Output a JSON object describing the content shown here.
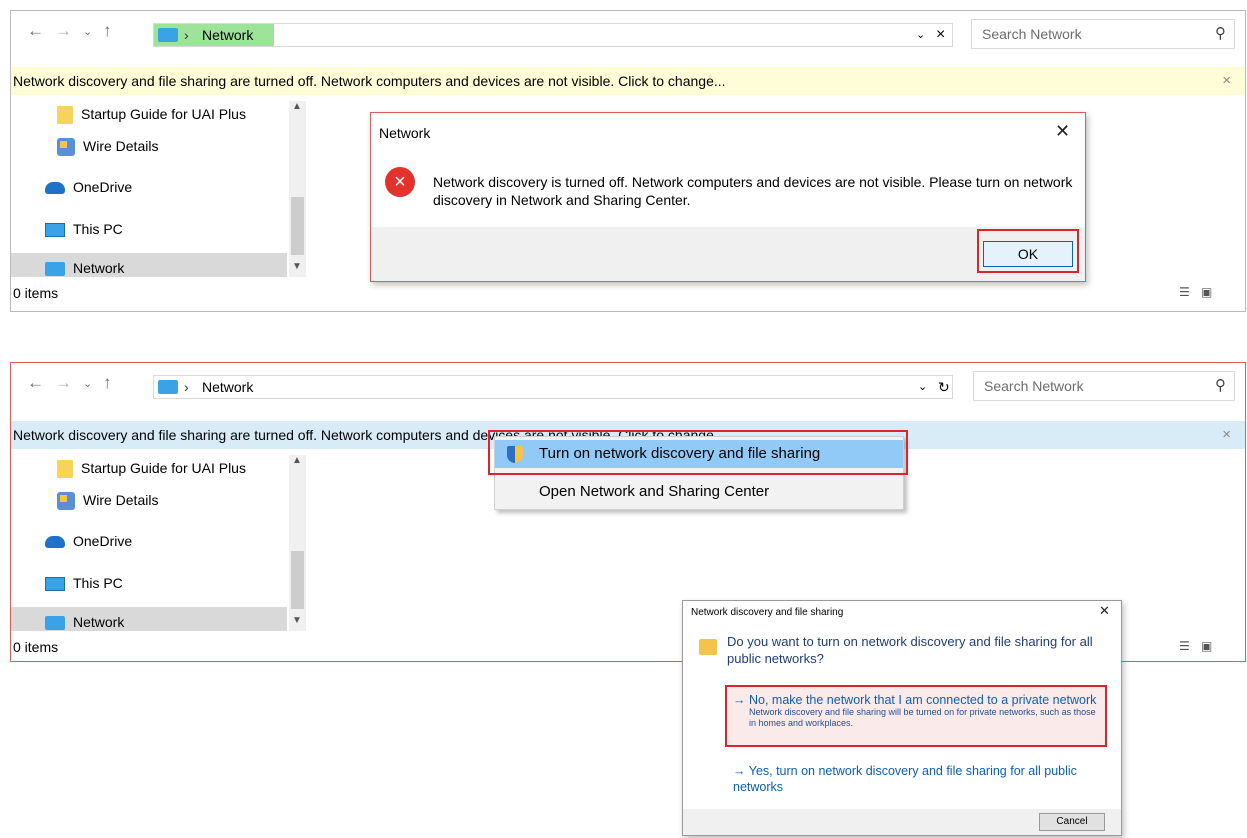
{
  "colors": {
    "accent": "#0b5fb8",
    "highlight_red": "#d9262c",
    "breadcrumb_green": "#9de39a",
    "infobar_yellow": "#fffdd6",
    "infobar_blue": "#d8ecf7"
  },
  "top": {
    "breadcrumb": "Network",
    "search_placeholder": "Search Network",
    "infobar_text": "Network discovery and file sharing are turned off. Network computers and devices are not visible. Click to change...",
    "nav_items": [
      {
        "label": "Startup Guide for UAI Plus",
        "icon": "folder-icon"
      },
      {
        "label": "Wire Details",
        "icon": "wire-icon"
      },
      {
        "label": "OneDrive",
        "icon": "onedrive-icon"
      },
      {
        "label": "This PC",
        "icon": "this-pc-icon"
      },
      {
        "label": "Network",
        "icon": "network-icon"
      }
    ],
    "status": "0 items",
    "dialog": {
      "title": "Network",
      "message": "Network discovery is turned off. Network computers and devices are not visible. Please turn on network discovery in Network and Sharing Center.",
      "ok_label": "OK"
    }
  },
  "bottom": {
    "breadcrumb": "Network",
    "search_placeholder": "Search Network",
    "infobar_text": "Network discovery and file sharing are turned off. Network computers and devices are not visible. Click to change...",
    "nav_items": [
      {
        "label": "Startup Guide for UAI Plus",
        "icon": "folder-icon"
      },
      {
        "label": "Wire Details",
        "icon": "wire-icon"
      },
      {
        "label": "OneDrive",
        "icon": "onedrive-icon"
      },
      {
        "label": "This PC",
        "icon": "this-pc-icon"
      },
      {
        "label": "Network",
        "icon": "network-icon"
      }
    ],
    "status": "0 items",
    "context_menu": {
      "item1": "Turn on network discovery and file sharing",
      "item2": "Open Network and Sharing Center"
    },
    "sharing_dialog": {
      "title": "Network discovery and file sharing",
      "question": "Do you want to turn on network discovery and file sharing for all public networks?",
      "option1_title": "No, make the network that I am connected to a private network",
      "option1_desc": "Network discovery and file sharing will be turned on for private networks, such as those in homes and workplaces.",
      "option2_title": "Yes, turn on network discovery and file sharing for all public networks",
      "cancel_label": "Cancel"
    }
  }
}
